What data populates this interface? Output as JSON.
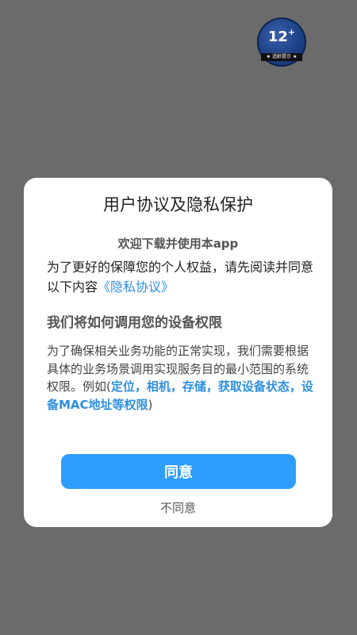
{
  "age_rating": {
    "number": "12",
    "plus": "+",
    "strip_text": "适龄提示",
    "strip_star": "★"
  },
  "dialog": {
    "title": "用户协议及隐私保护",
    "welcome": "欢迎下载并使用本app",
    "intro_text": "为了更好的保障您的个人权益，请先阅读并同意以下内容",
    "privacy_link": "《隐私协议》",
    "permission_heading": "我们将如何调用您的设备权限",
    "permission_text_before": "为了确保相关业务功能的正常实现，我们需要根据具体的业务场景调用实现服务目的最小范围的系统权限。例如(",
    "permission_examples": "定位，相机，存储，获取设备状态，设备MAC地址等权限",
    "permission_text_after": ")",
    "agree_label": "同意",
    "disagree_label": "不同意"
  },
  "colors": {
    "overlay": "#6b6b6b",
    "accent": "#2e9dfc",
    "link": "#2e8fe0"
  }
}
